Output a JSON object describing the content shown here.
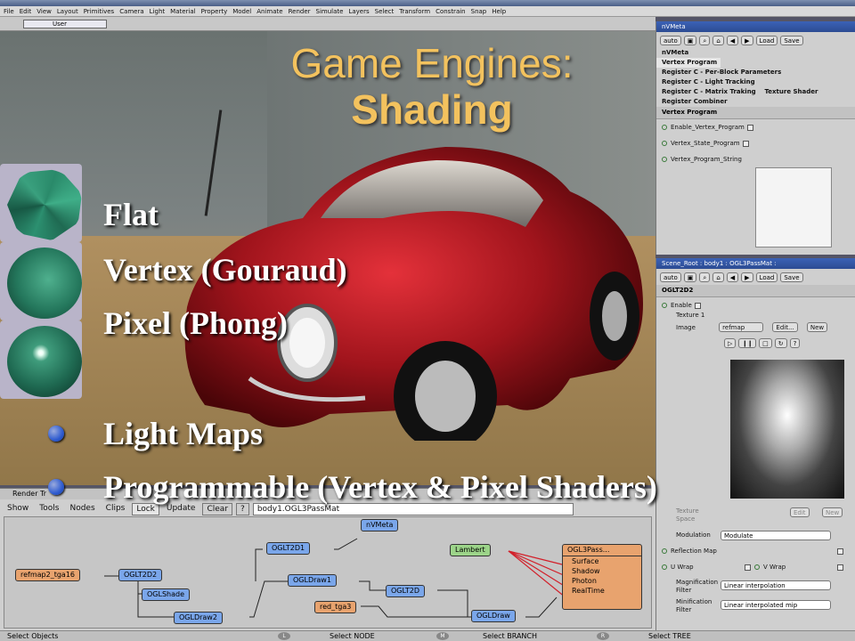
{
  "app": {
    "menu": [
      "File",
      "Edit",
      "View",
      "Layout",
      "Primitives",
      "Camera",
      "Light",
      "Material",
      "Property",
      "Model",
      "Animate",
      "Render",
      "Simulate",
      "Layers",
      "Select",
      "Transform",
      "Constrain",
      "Snap",
      "Help"
    ],
    "user_label": "User"
  },
  "slide": {
    "title": "Game Engines:",
    "subtitle": "Shading",
    "bullets": [
      "Flat",
      "Vertex (Gouraud)",
      "Pixel (Phong)",
      "Light Maps",
      "Programmable (Vertex & Pixel Shaders)"
    ]
  },
  "panel_meta": {
    "title": "nVMeta",
    "auto": "auto",
    "load": "Load",
    "save": "Save",
    "header": "nVMeta",
    "tab": "Vertex Program",
    "rows": [
      "Register C - Per-Block Parameters",
      "Register C - Light Tracking",
      "Register C - Matrix Traking",
      "Register Combiner"
    ],
    "texture_shader": "Texture Shader",
    "section": "Vertex Program",
    "params": [
      "Enable_Vertex_Program",
      "Vertex_State_Program",
      "Vertex_Program_String"
    ]
  },
  "panel_mat": {
    "title": "Scene_Root : body1 : OGL3PassMat :",
    "auto": "auto",
    "load": "Load",
    "save": "Save",
    "section": "OGLT2D2",
    "enable": "Enable",
    "texture": "Texture 1",
    "image": "Image",
    "image_value": "refmap",
    "edit": "Edit...",
    "new": "New",
    "texture_space": "Texture Space",
    "edit2": "Edit",
    "new2": "New",
    "modulation": "Modulation",
    "modulation_value": "Modulate",
    "reflection_map": "Reflection Map",
    "u_wrap": "U Wrap",
    "v_wrap": "V Wrap",
    "mag_filter": "Magnification Filter",
    "mag_value": "Linear interpolation",
    "min_filter": "Minification Filter",
    "min_value": "Linear interpolated mip"
  },
  "render_tree": {
    "title": "Render Tr",
    "tabs": [
      "Show",
      "Tools",
      "Nodes",
      "Clips",
      "Lock",
      "Update",
      "Clear",
      "?"
    ],
    "path": "body1.OGL3PassMat",
    "nodes": {
      "nvmeta": "nVMeta",
      "oglt2d1": "OGLT2D1",
      "lambert": "Lambert",
      "ogl3pass": "OGL3Pass...",
      "refmap2": "refmap2_tga16",
      "oglt2d2": "OGLT2D2",
      "oglshade": "OGLShade",
      "ogldraw1": "OGLDraw1",
      "oglt2d": "OGLT2D",
      "ogldraw2": "OGLDraw2",
      "red_tga3": "red_tga3",
      "ogldraw": "OGLDraw",
      "ports": [
        "Surface",
        "Shadow",
        "Photon",
        "RealTime"
      ]
    }
  },
  "status": {
    "left": "Select Objects",
    "l_key": "L",
    "mid": "Select NODE",
    "m_key": "M",
    "branch": "Select BRANCH",
    "r_key": "R",
    "tree": "Select TREE"
  }
}
